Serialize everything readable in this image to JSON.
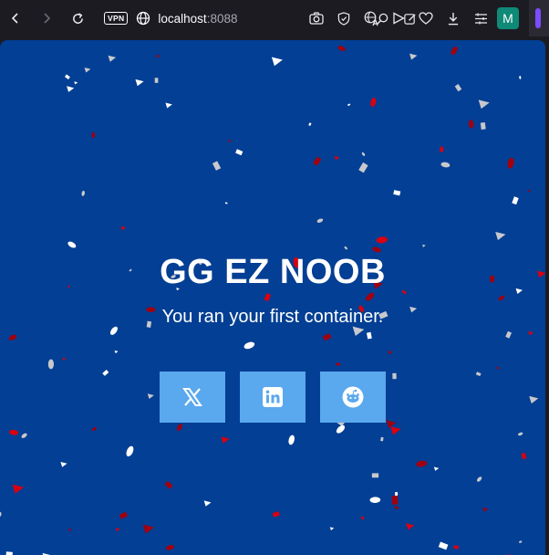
{
  "browser": {
    "address_badge": "VPN",
    "url_host": "localhost",
    "url_port": ":8088",
    "profile_initial": "M",
    "icons": [
      "back-icon",
      "forward-icon",
      "reload-icon",
      "vpn-badge",
      "globe-icon",
      "zoom-icon",
      "edit-icon",
      "screenshot-icon",
      "shield-icon",
      "translate-icon",
      "send-icon",
      "heart-icon",
      "download-icon",
      "menu-icon"
    ]
  },
  "page": {
    "headline": "GG EZ NOOB",
    "subline": "You ran your first container.",
    "background_color": "#033f94",
    "share_buttons": [
      {
        "name": "x",
        "icon": "x-logo-icon"
      },
      {
        "name": "linkedin",
        "icon": "linkedin-logo-icon"
      },
      {
        "name": "reddit",
        "icon": "reddit-logo-icon"
      }
    ],
    "confetti_colors": [
      "#ffffff",
      "#c8c8cc",
      "#d90010",
      "#a00010"
    ]
  }
}
